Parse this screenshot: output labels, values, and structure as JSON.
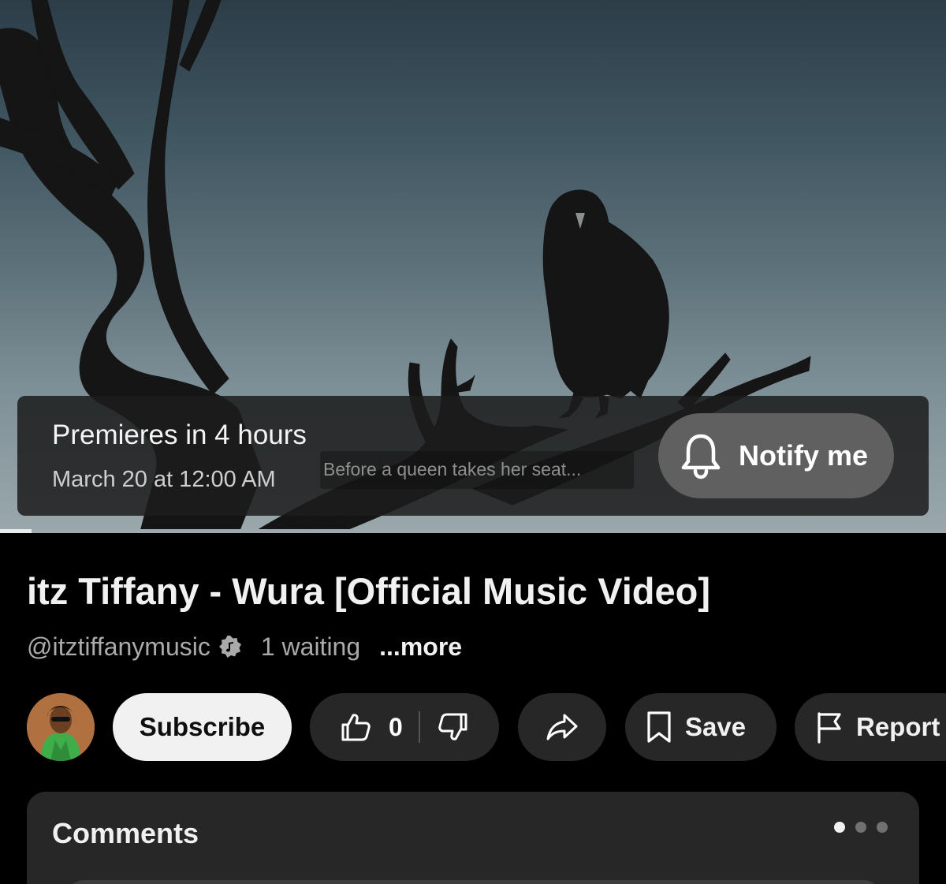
{
  "premiere": {
    "status": "Premieres in 4 hours",
    "date": "March 20 at 12:00 AM",
    "teaser": "Before a queen takes her seat...",
    "notify_label": "Notify me"
  },
  "video": {
    "title": "itz Tiffany - Wura [Official Music Video]",
    "progress_fraction": 0.03
  },
  "channel": {
    "handle": "@itztiffanymusic",
    "badge_icon": "music-note-verified-icon",
    "waiting": "1 waiting",
    "more_label": "...more"
  },
  "actions": {
    "subscribe_label": "Subscribe",
    "like_count": "0",
    "save_label": "Save",
    "report_label": "Report",
    "icons": [
      "thumbs-up-icon",
      "thumbs-down-icon",
      "share-icon",
      "bookmark-icon",
      "flag-icon"
    ]
  },
  "comments": {
    "heading": "Comments",
    "page_count": 3,
    "active_page": 1
  },
  "colors": {
    "background": "#000000",
    "pill_background": "#272727",
    "subscribe_background": "#f1f1f1",
    "notify_background": "#606060",
    "secondary_text": "#aaaaaa"
  }
}
